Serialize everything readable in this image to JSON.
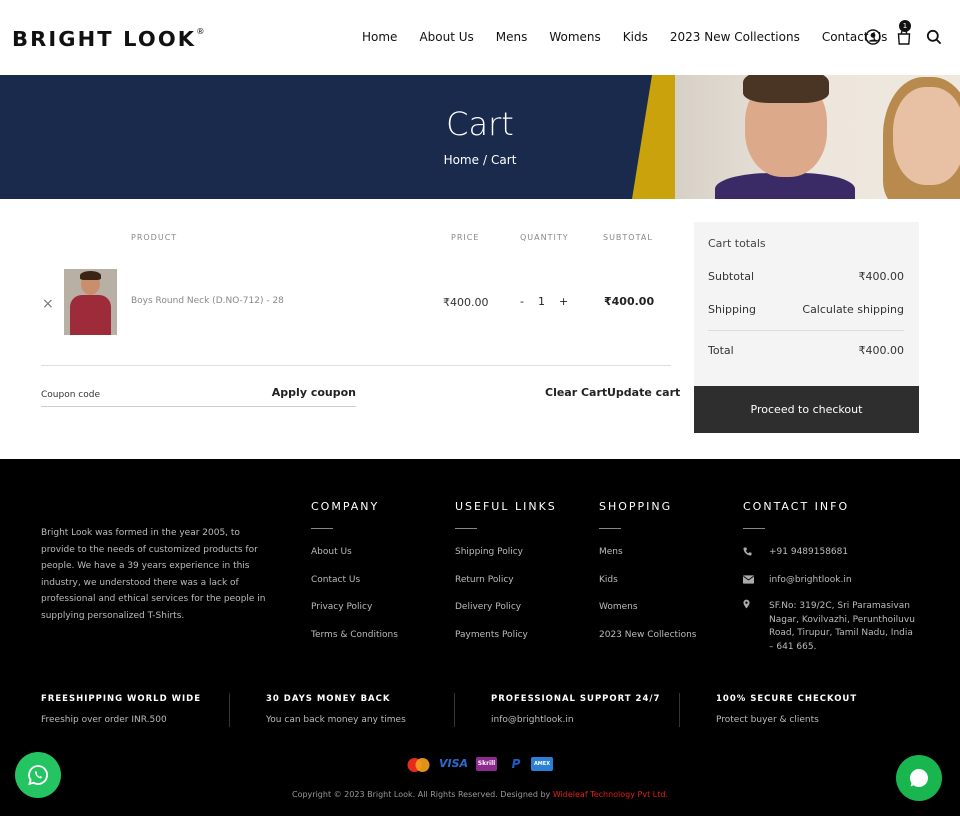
{
  "header": {
    "logo": "BRIGHT LOOK",
    "logo_mark": "®",
    "nav": [
      "Home",
      "About Us",
      "Mens",
      "Womens",
      "Kids",
      "2023 New Collections",
      "Contact Us"
    ],
    "cart_count": "1"
  },
  "hero": {
    "title": "Cart",
    "breadcrumb": {
      "home": "Home",
      "sep": "/",
      "current": "Cart"
    }
  },
  "cart": {
    "columns": {
      "product": "PRODUCT",
      "price": "PRICE",
      "quantity": "QUANTITY",
      "subtotal": "SUBTOTAL"
    },
    "item": {
      "remove": "×",
      "name": "Boys Round Neck (D.NO-712) - 28",
      "price": "₹400.00",
      "qty_minus": "-",
      "qty": "1",
      "qty_plus": "+",
      "subtotal": "₹400.00"
    },
    "coupon_placeholder": "Coupon code",
    "apply_coupon": "Apply coupon",
    "clear_cart": "Clear Cart",
    "update_cart": "Update cart"
  },
  "totals": {
    "title": "Cart totals",
    "subtotal_label": "Subtotal",
    "subtotal_value": "₹400.00",
    "shipping_label": "Shipping",
    "shipping_value": "Calculate shipping",
    "total_label": "Total",
    "total_value": "₹400.00",
    "checkout": "Proceed to checkout"
  },
  "footer": {
    "about": "Bright Look was formed in the year 2005, to provide to the needs of customized products for people. We have a 39 years experience in this industry, we understood there was a lack of professional and ethical services for the people in supplying personalized T-Shirts.",
    "company": {
      "title": "COMPANY",
      "links": [
        "About Us",
        "Contact Us",
        "Privacy Policy",
        "Terms & Conditions"
      ]
    },
    "useful": {
      "title": "USEFUL LINKS",
      "links": [
        "Shipping Policy",
        "Return Policy",
        "Delivery Policy",
        "Payments Policy"
      ]
    },
    "shopping": {
      "title": "SHOPPING",
      "links": [
        "Mens",
        "Kids",
        "Womens",
        "2023 New Collections"
      ]
    },
    "contact": {
      "title": "CONTACT INFO",
      "phone": "+91 9489158681",
      "email": "info@brightlook.in",
      "address": "SF.No: 319/2C, Sri Paramasivan Nagar, Kovilvazhi, Perunthoiluvu Road, Tirupur, Tamil Nadu, India – 641 665."
    },
    "features": [
      {
        "title": "FREESHIPPING WORLD WIDE",
        "sub": "Freeship over order INR.500"
      },
      {
        "title": "30 DAYS MONEY BACK",
        "sub": "You can back money any times"
      },
      {
        "title": "PROFESSIONAL SUPPORT 24/7",
        "sub": "info@brightlook.in"
      },
      {
        "title": "100% SECURE CHECKOUT",
        "sub": "Protect buyer & clients"
      }
    ],
    "payments": [
      "MasterCard",
      "VISA",
      "Skrill",
      "P",
      "AMEX"
    ],
    "copyright": "Copyright © 2023 Bright Look. All Rights Reserved. Designed by",
    "designer": "Wideleaf Technology Pvt Ltd."
  },
  "colors": {
    "hero_bg": "#1a2a4d",
    "accent_yellow": "#c9a20c",
    "checkout_bg": "#2e2e2e",
    "footer_bg": "#000000",
    "whatsapp": "#25c463",
    "designer_link": "#e0201a"
  },
  "icons": [
    "user-icon",
    "bag-icon",
    "search-icon",
    "close-icon",
    "phone-icon",
    "envelope-icon",
    "map-marker-icon",
    "whatsapp-icon",
    "chat-bubble-icon"
  ]
}
